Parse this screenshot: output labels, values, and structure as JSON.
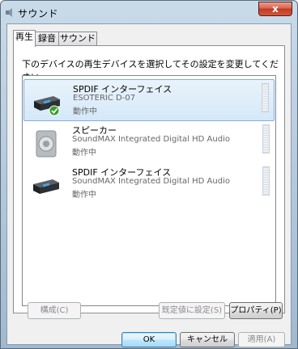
{
  "window": {
    "title": "サウンド",
    "close_glyph": "x"
  },
  "tabs": [
    {
      "label": "再生",
      "active": true
    },
    {
      "label": "録音",
      "active": false
    },
    {
      "label": "サウンド",
      "active": false
    }
  ],
  "instruction": "下のデバイスの再生デバイスを選択してその設定を変更してください:",
  "devices": [
    {
      "name": "SPDIF インターフェイス",
      "desc": "ESOTERIC D-07",
      "status": "動作中",
      "icon": "digital-output-device-icon",
      "selected": true,
      "is_default": true
    },
    {
      "name": "スピーカー",
      "desc": "SoundMAX Integrated Digital HD Audio",
      "status": "動作中",
      "icon": "speaker-icon",
      "selected": false,
      "is_default": false
    },
    {
      "name": "SPDIF インターフェイス",
      "desc": "SoundMAX Integrated Digital HD Audio",
      "status": "動作中",
      "icon": "digital-output-device-icon",
      "selected": false,
      "is_default": false
    }
  ],
  "buttons": {
    "configure": "構成(C)",
    "set_default": "既定値に設定(S)",
    "properties": "プロパティ(P)",
    "ok": "OK",
    "cancel": "キャンセル",
    "apply": "適用(A)"
  },
  "colors": {
    "selection_border": "#84acdd",
    "default_check": "#3a9a2a",
    "close_button": "#c13a22"
  }
}
